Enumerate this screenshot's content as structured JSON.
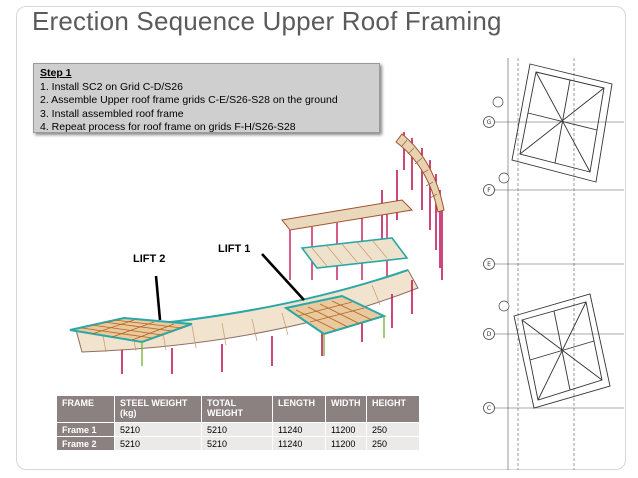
{
  "slide": {
    "title": "Erection Sequence Upper Roof Framing"
  },
  "step": {
    "heading": "Step 1",
    "items": [
      "1.  Install SC2 on Grid C-D/S26",
      "2.  Assemble Upper roof frame grids C-E/S26-S28 on the ground",
      "3.  Install assembled roof frame",
      "4.  Repeat process for roof frame on grids F-H/S26-S28"
    ]
  },
  "model": {
    "lift1_label": "LIFT 1",
    "lift2_label": "LIFT 2"
  },
  "plan": {
    "grid_labels": [
      "G",
      "F",
      "E",
      "D",
      "C"
    ]
  },
  "table": {
    "headers": [
      "FRAME",
      "STEEL WEIGHT (kg)",
      "TOTAL WEIGHT",
      "LENGTH",
      "WIDTH",
      "HEIGHT"
    ],
    "rows": [
      [
        "Frame 1",
        "5210",
        "5210",
        "11240",
        "11200",
        "250"
      ],
      [
        "Frame 2",
        "5210",
        "5210",
        "11240",
        "11200",
        "250"
      ]
    ]
  }
}
